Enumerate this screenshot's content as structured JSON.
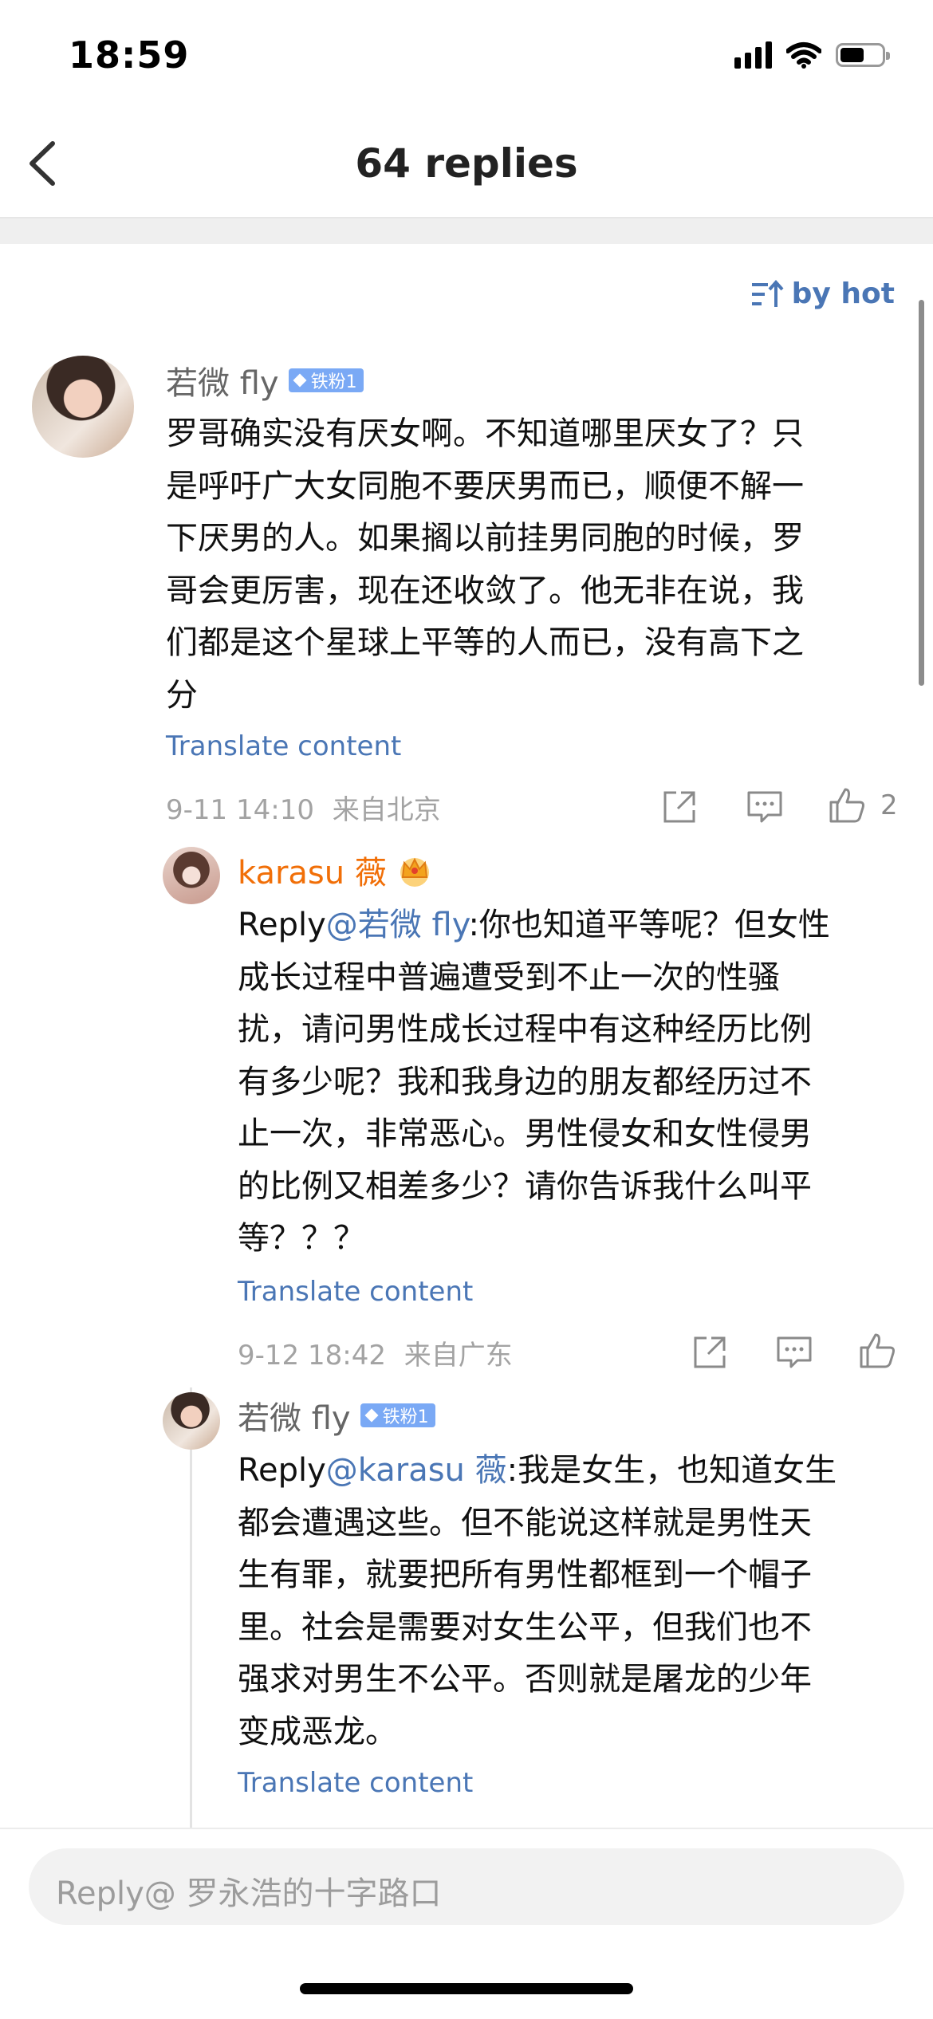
{
  "status_bar": {
    "time": "18:59",
    "battery_level": 0.58
  },
  "header": {
    "title": "64 replies",
    "back_icon": "chevron-left-icon"
  },
  "sort": {
    "label": "by hot",
    "icon": "sort-icon"
  },
  "comment": {
    "user": "若微 fly",
    "badge": "铁粉1",
    "content_lines": [
      "罗哥确实没有厌女啊。不知道哪里厌女了？只",
      "是呼吁广大女同胞不要厌男而已，顺便不解一",
      "下厌男的人。如果搁以前挂男同胞的时候，罗",
      "哥会更厉害，现在还收敛了。他无非在说，我",
      "们都是这个星球上平等的人而已，没有高下之",
      "分"
    ],
    "translate": "Translate content",
    "time": "9-11 14:10",
    "location": "来自北京",
    "like_count": "2"
  },
  "replies": [
    {
      "user": "karasu 薇",
      "crown_icon": "crown-icon",
      "reply_prefix": "Reply",
      "mention": "@若微 fly",
      "line0_rest": ":你也知道平等呢？但女性",
      "lines": [
        "成长过程中普遍遭受到不止一次的性骚",
        "扰，请问男性成长过程中有这种经历比例",
        "有多少呢？我和我身边的朋友都经历过不",
        "止一次，非常恶心。男性侵女和女性侵男",
        "的比例又相差多少？请你告诉我什么叫平",
        "等？？？"
      ],
      "translate": "Translate content",
      "time": "9-12 18:42",
      "location": "来自广东"
    },
    {
      "user": "若微 fly",
      "badge": "铁粉1",
      "reply_prefix": "Reply",
      "mention": "@karasu 薇",
      "line0_rest": ":我是女生，也知道女生",
      "lines": [
        "都会遭遇这些。但不能说这样就是男性天",
        "生有罪，就要把所有男性都框到一个帽子",
        "里。社会是需要对女生公平，但我们也不",
        "强求对男生不公平。否则就是屠龙的少年",
        "变成恶龙。"
      ],
      "translate": "Translate content"
    }
  ],
  "reply_input": {
    "placeholder": "Reply@ 罗永浩的十字路口"
  },
  "colors": {
    "link": "#4a76b5",
    "orange_name": "#f16f08",
    "badge": "#7aa9f5",
    "meta": "#a3a3a3"
  }
}
